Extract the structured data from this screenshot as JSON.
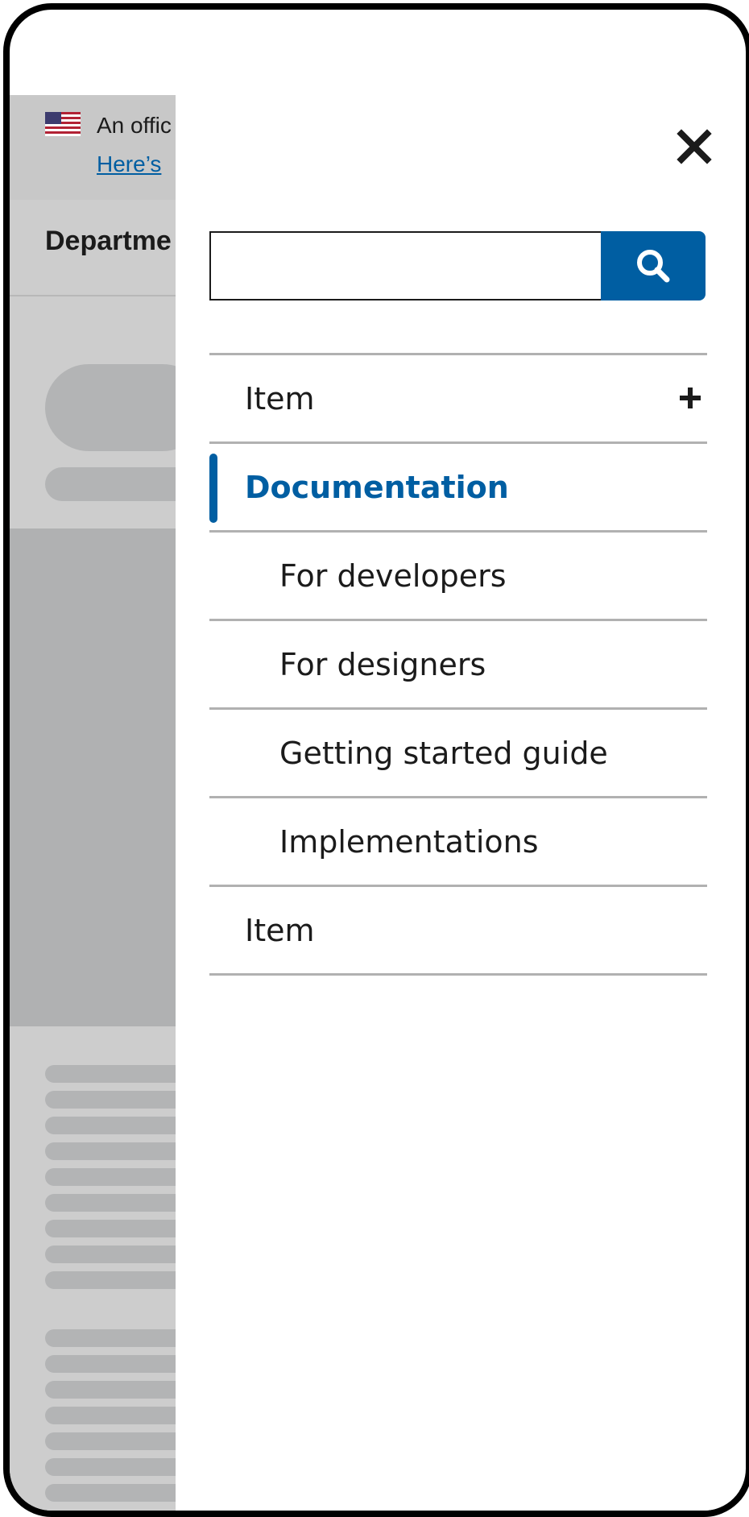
{
  "banner": {
    "text": "An offic",
    "link": "Here’s"
  },
  "header": {
    "agency": "Departme"
  },
  "drawer": {
    "close_icon": "close-icon",
    "search": {
      "value": "",
      "placeholder": "",
      "icon": "search-icon"
    },
    "nav": {
      "items": [
        {
          "label": "Item",
          "expandable": true,
          "icon": "plus-icon"
        },
        {
          "label": "Documentation",
          "current": true
        },
        {
          "label": "For developers",
          "sub": true
        },
        {
          "label": "For designers",
          "sub": true
        },
        {
          "label": "Getting started guide",
          "sub": true
        },
        {
          "label": "Implementations",
          "sub": true
        },
        {
          "label": "Item"
        }
      ]
    }
  },
  "colors": {
    "primary": "#005ea2",
    "overlay": "#cdcdcd",
    "divider": "#b1b1b1"
  }
}
